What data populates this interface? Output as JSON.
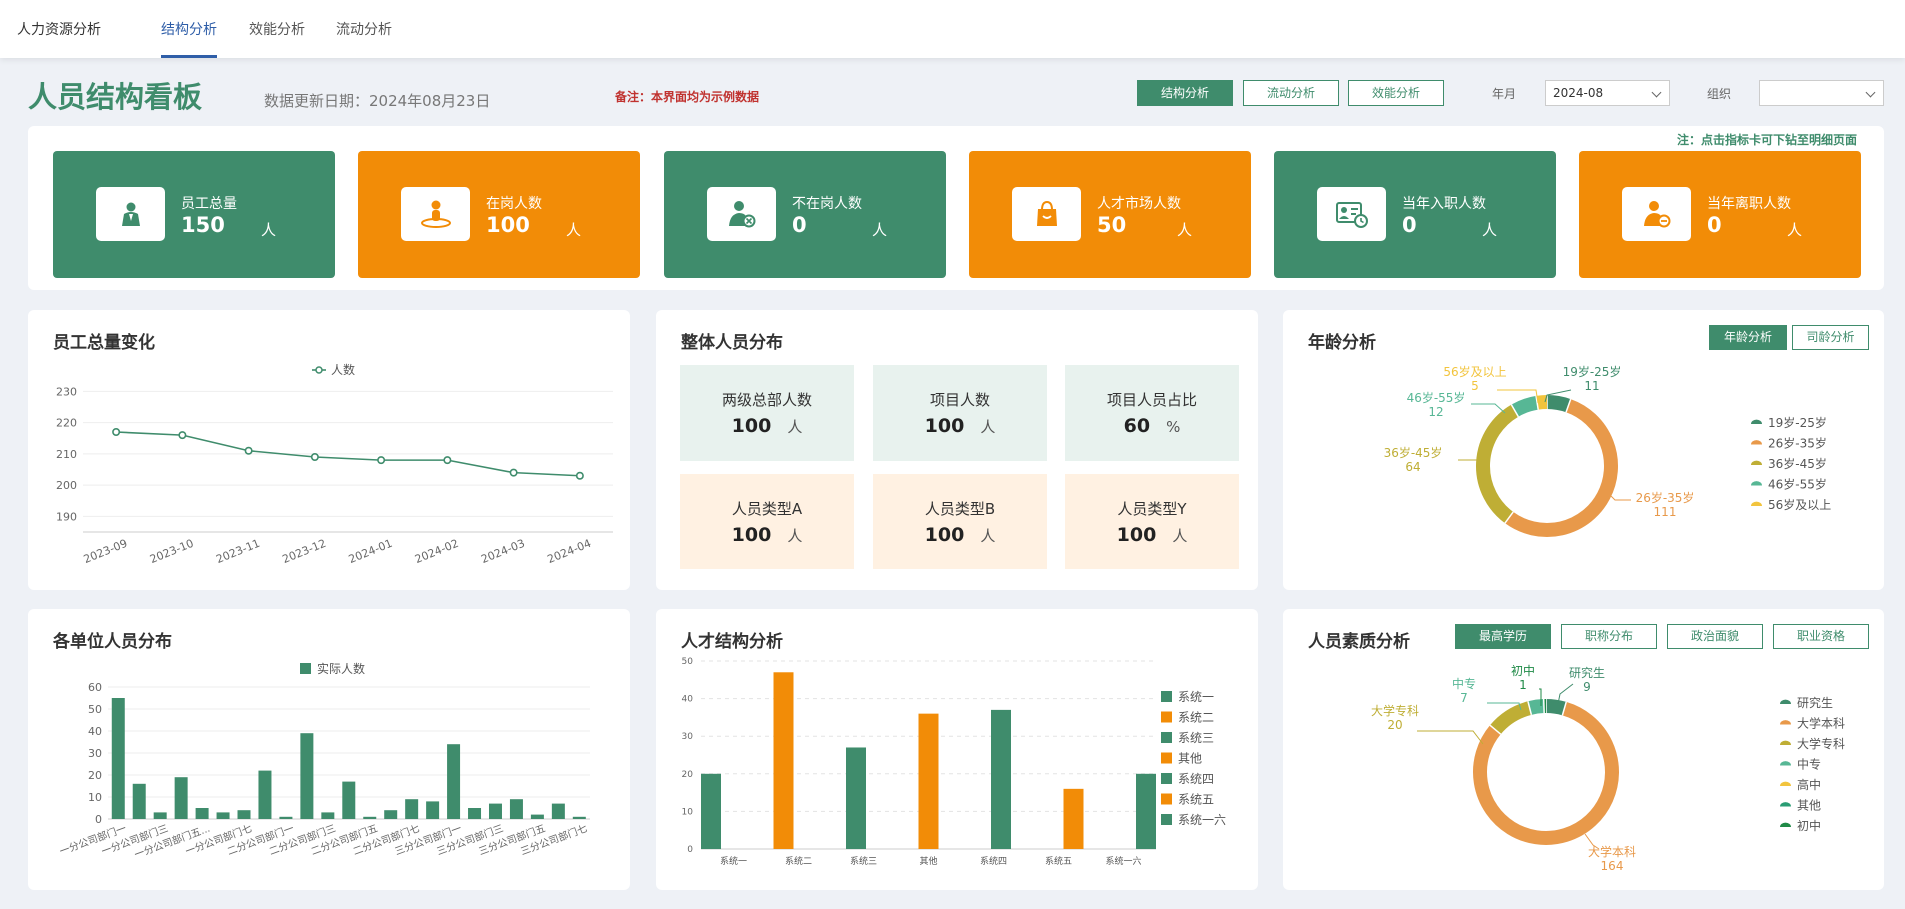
{
  "nav": {
    "brand": "人力资源分析",
    "tabs": [
      "结构分析",
      "效能分析",
      "流动分析"
    ]
  },
  "header": {
    "title": "人员结构看板",
    "update_date": "数据更新日期：2024年08月23日",
    "note": "备注：本界面均为示例数据",
    "buttons": [
      "结构分析",
      "流动分析",
      "效能分析"
    ],
    "month_label": "年月",
    "month_value": "2024-08",
    "org_label": "组织",
    "org_value": ""
  },
  "drill_note": "注：点击指标卡可下钻至明细页面",
  "kpis": [
    {
      "label": "员工总量",
      "value": "150",
      "unit": "人",
      "icon": "employees-icon",
      "color": "#3f8c6c"
    },
    {
      "label": "在岗人数",
      "value": "100",
      "unit": "人",
      "icon": "on-duty-icon",
      "color": "#f28c07"
    },
    {
      "label": "不在岗人数",
      "value": "0",
      "unit": "人",
      "icon": "off-duty-icon",
      "color": "#3f8c6c"
    },
    {
      "label": "人才市场人数",
      "value": "50",
      "unit": "人",
      "icon": "shopping-bag-icon",
      "color": "#f28c07"
    },
    {
      "label": "当年入职人数",
      "value": "0",
      "unit": "人",
      "icon": "id-card-icon",
      "color": "#3f8c6c"
    },
    {
      "label": "当年离职人数",
      "value": "0",
      "unit": "人",
      "icon": "person-leave-icon",
      "color": "#f28c07"
    }
  ],
  "panels": {
    "total_trend": {
      "title": "员工总量变化"
    },
    "overall": {
      "title": "整体人员分布",
      "cells": [
        {
          "label": "两级总部人数",
          "value": "100",
          "unit": "人"
        },
        {
          "label": "项目人数",
          "value": "100",
          "unit": "人"
        },
        {
          "label": "项目人员占比",
          "value": "60",
          "unit": "%"
        },
        {
          "label": "人员类型A",
          "value": "100",
          "unit": "人"
        },
        {
          "label": "人员类型B",
          "value": "100",
          "unit": "人"
        },
        {
          "label": "人员类型Y",
          "value": "100",
          "unit": "人"
        }
      ]
    },
    "age": {
      "title": "年龄分析",
      "tabs": [
        "年龄分析",
        "司龄分析"
      ]
    },
    "unit_dist": {
      "title": "各单位人员分布"
    },
    "talent": {
      "title": "人才结构分析"
    },
    "quality": {
      "title": "人员素质分析",
      "tabs": [
        "最高学历",
        "职称分布",
        "政治面貌",
        "职业资格"
      ]
    }
  },
  "chart_data": [
    {
      "type": "line",
      "title": "",
      "series": [
        {
          "name": "人数",
          "values": [
            217,
            216,
            211,
            209,
            208,
            208,
            204,
            203
          ]
        }
      ],
      "categories": [
        "2023-09",
        "2023-10",
        "2023-11",
        "2023-12",
        "2024-01",
        "2024-02",
        "2024-03",
        "2024-04"
      ],
      "yticks": [
        190,
        200,
        210,
        220,
        230
      ],
      "ylim": [
        185,
        233
      ],
      "color": "#3f8c6c",
      "legend": "top-center"
    },
    {
      "type": "pie",
      "title": "",
      "slices": [
        {
          "name": "19岁-25岁",
          "value": 11,
          "color": "#3f8c6c"
        },
        {
          "name": "26岁-35岁",
          "value": 111,
          "color": "#e8994a"
        },
        {
          "name": "36岁-45岁",
          "value": 64,
          "color": "#bfae35"
        },
        {
          "name": "46岁-55岁",
          "value": 12,
          "color": "#57b795"
        },
        {
          "name": "56岁及以上",
          "value": 5,
          "color": "#f2c43d"
        }
      ],
      "legend": "right"
    },
    {
      "type": "bar",
      "title": "",
      "series": [
        {
          "name": "实际人数",
          "values": [
            55,
            16,
            3,
            19,
            5,
            3,
            4,
            22,
            1,
            39,
            3,
            17,
            1,
            4,
            9,
            8,
            34,
            5,
            7,
            9,
            2,
            7,
            1
          ]
        }
      ],
      "tick_labels": [
        "一分公司部门一",
        "一分公司部门三",
        "一分公司部门五...",
        "一分公司部门七",
        "二分公司部门一",
        "二分公司部门三",
        "二分公司部门五",
        "二分公司部门七",
        "三分公司部门一",
        "三分公司部门三",
        "三分公司部门五",
        "三分公司部门七"
      ],
      "yticks": [
        0,
        10,
        20,
        30,
        40,
        50,
        60
      ],
      "ylim": [
        0,
        60
      ],
      "color": "#3f8c6c",
      "legend": "top-center"
    },
    {
      "type": "bar",
      "title": "",
      "categories": [
        "系统一",
        "系统二",
        "系统三",
        "其他",
        "系统四",
        "系统五",
        "系统一六"
      ],
      "series": [
        {
          "name": "系统一",
          "values": [
            20,
            0,
            0,
            0,
            0,
            0,
            0
          ]
        },
        {
          "name": "系统二",
          "values": [
            0,
            47,
            0,
            0,
            0,
            0,
            0
          ]
        },
        {
          "name": "系统三",
          "values": [
            0,
            0,
            27,
            0,
            0,
            0,
            0
          ]
        },
        {
          "name": "其他",
          "values": [
            0,
            0,
            0,
            36,
            0,
            0,
            0
          ]
        },
        {
          "name": "系统四",
          "values": [
            0,
            0,
            0,
            0,
            37,
            0,
            0
          ]
        },
        {
          "name": "系统五",
          "values": [
            0,
            0,
            0,
            0,
            0,
            16,
            0
          ]
        },
        {
          "name": "系统一六",
          "values": [
            0,
            0,
            0,
            0,
            0,
            0,
            20
          ]
        }
      ],
      "series_colors": [
        "#3f8c6c",
        "#f28c07",
        "#3f8c6c",
        "#f28c07",
        "#3f8c6c",
        "#f28c07",
        "#3f8c6c"
      ],
      "yticks": [
        0,
        10,
        20,
        30,
        40,
        50
      ],
      "ylim": [
        0,
        50
      ],
      "legend": "right"
    },
    {
      "type": "pie",
      "title": "",
      "slices": [
        {
          "name": "研究生",
          "value": 9,
          "color": "#3f8c6c"
        },
        {
          "name": "大学本科",
          "value": 164,
          "color": "#e8994a"
        },
        {
          "name": "大学专科",
          "value": 20,
          "color": "#bfae35"
        },
        {
          "name": "中专",
          "value": 7,
          "color": "#57b795"
        },
        {
          "name": "高中",
          "value": 0,
          "color": "#f2c43d"
        },
        {
          "name": "其他",
          "value": 0,
          "color": "#2a9d74"
        },
        {
          "name": "初中",
          "value": 1,
          "color": "#1f8a47"
        }
      ],
      "legend": "right"
    }
  ]
}
